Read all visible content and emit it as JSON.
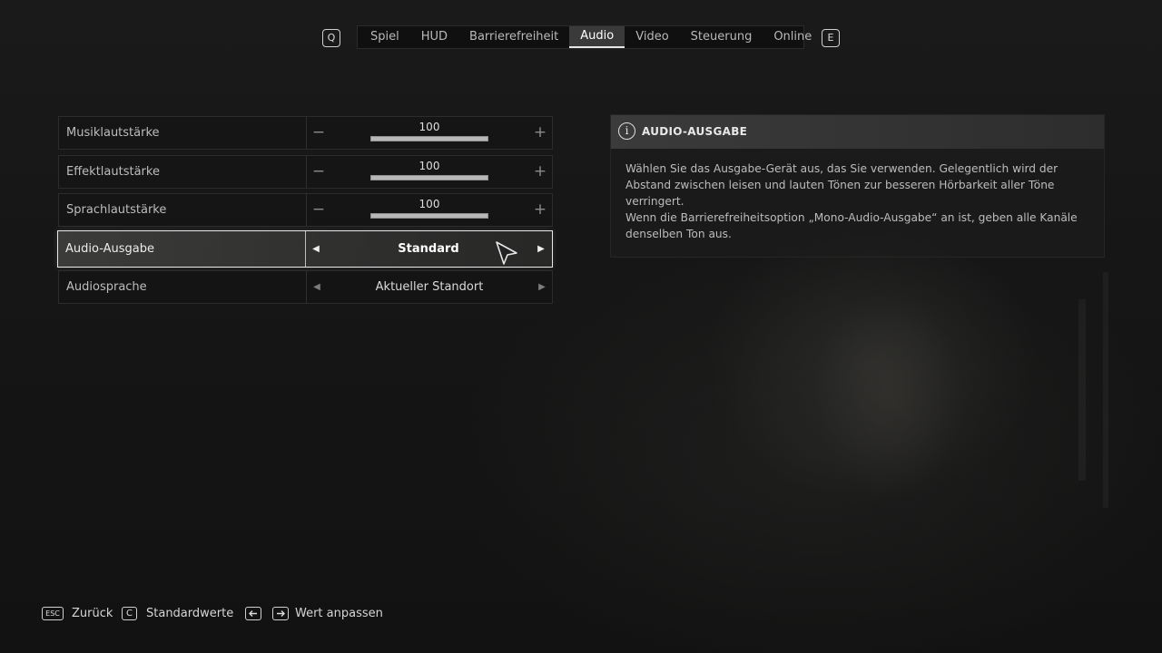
{
  "nav": {
    "prev_key": "Q",
    "next_key": "E",
    "tabs": [
      {
        "label": "Spiel"
      },
      {
        "label": "HUD"
      },
      {
        "label": "Barrierefreiheit"
      },
      {
        "label": "Audio",
        "active": true
      },
      {
        "label": "Video"
      },
      {
        "label": "Steuerung"
      },
      {
        "label": "Online"
      }
    ]
  },
  "settings": {
    "music": {
      "label": "Musiklautstärke",
      "value": "100",
      "level": 1.0
    },
    "effects": {
      "label": "Effektlautstärke",
      "value": "100",
      "level": 1.0
    },
    "speech": {
      "label": "Sprachlautstärke",
      "value": "100",
      "level": 1.0
    },
    "audio_output": {
      "label": "Audio-Ausgabe",
      "value": "Standard",
      "selected": true
    },
    "audio_language": {
      "label": "Audiosprache",
      "value": "Aktueller Standort"
    }
  },
  "info": {
    "icon": "info-icon",
    "icon_glyph": "i",
    "title": "AUDIO-AUSGABE",
    "paragraph1": "Wählen Sie das Ausgabe-Gerät aus, das Sie verwenden. Gelegentlich wird der Abstand zwischen leisen und lauten Tönen zur besseren Hörbarkeit aller Töne verringert.",
    "paragraph2": "Wenn die Barrierefreiheitsoption „Mono-Audio-Ausgabe“ an ist, geben alle Kanäle denselben Ton aus."
  },
  "hints": {
    "back_key": "ESC",
    "back_label": "Zurück",
    "defaults_key": "C",
    "defaults_label": "Standardwerte",
    "adjust_left_icon": "arrow-left-icon",
    "adjust_right_icon": "arrow-right-icon",
    "adjust_label": "Wert anpassen"
  },
  "colors": {
    "background": "#141414",
    "accent": "#e9e9e9"
  }
}
